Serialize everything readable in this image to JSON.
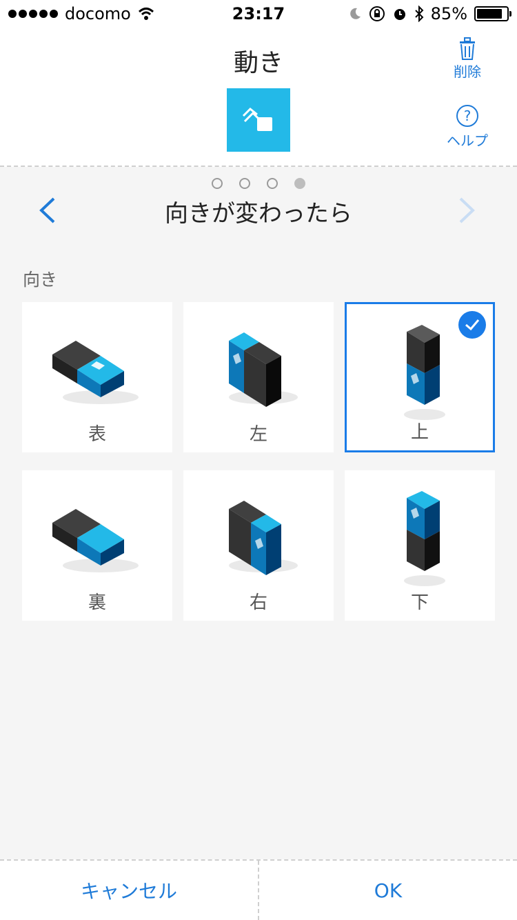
{
  "status_bar": {
    "carrier": "docomo",
    "time": "23:17",
    "battery": "85%",
    "battery_level": 0.85,
    "icons": [
      "signal-dots-icon",
      "wifi-icon",
      "moon-icon",
      "orientation-lock-icon",
      "alarm-icon",
      "bluetooth-icon",
      "battery-icon"
    ]
  },
  "header": {
    "title": "動き",
    "delete_label": "削除",
    "help_label": "ヘルプ",
    "help_glyph": "?",
    "mode_icon": "motion-blocks-icon",
    "mode_color": "#23b9e8"
  },
  "pager": {
    "total": 4,
    "current": 4,
    "step_title": "向きが変わったら"
  },
  "section_label": "向き",
  "orientations": [
    {
      "label": "表",
      "selected": false
    },
    {
      "label": "左",
      "selected": false
    },
    {
      "label": "上",
      "selected": true
    },
    {
      "label": "裏",
      "selected": false
    },
    {
      "label": "右",
      "selected": false
    },
    {
      "label": "下",
      "selected": false
    }
  ],
  "footer": {
    "cancel_label": "キャンセル",
    "ok_label": "OK"
  },
  "colors": {
    "accent": "#1f7bd8",
    "selection": "#1a7ce8",
    "block_blue": "#23b9e8",
    "block_dark": "#333333"
  }
}
